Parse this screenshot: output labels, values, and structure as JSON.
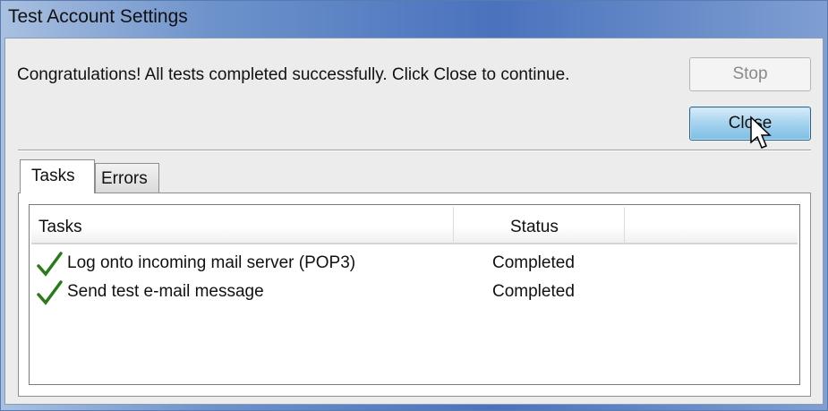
{
  "window": {
    "title": "Test Account Settings"
  },
  "message": "Congratulations! All tests completed successfully. Click Close to continue.",
  "buttons": {
    "stop": "Stop",
    "close": "Close"
  },
  "tabs": [
    {
      "label": "Tasks",
      "active": true
    },
    {
      "label": "Errors",
      "active": false
    }
  ],
  "table": {
    "columns": [
      "Tasks",
      "Status"
    ],
    "rows": [
      {
        "icon": "checkmark-icon",
        "task": "Log onto incoming mail server (POP3)",
        "status": "Completed"
      },
      {
        "icon": "checkmark-icon",
        "task": "Send test e-mail message",
        "status": "Completed"
      }
    ]
  },
  "colors": {
    "check": "#2a7a1a",
    "close_button": "#a4d2ee",
    "titlebar": "#4a72bd"
  }
}
